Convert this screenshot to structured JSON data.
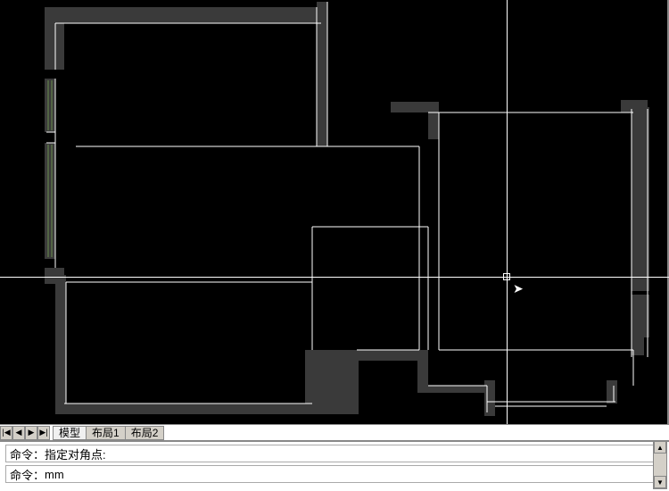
{
  "tabs": {
    "model": "模型",
    "layout1": "布局1",
    "layout2": "布局2"
  },
  "command": {
    "prefix": "命令：",
    "line1": "指定对角点:",
    "line2": "mm"
  },
  "nav": {
    "first": "|◀",
    "prev": "◀",
    "next": "▶",
    "last": "▶|"
  }
}
